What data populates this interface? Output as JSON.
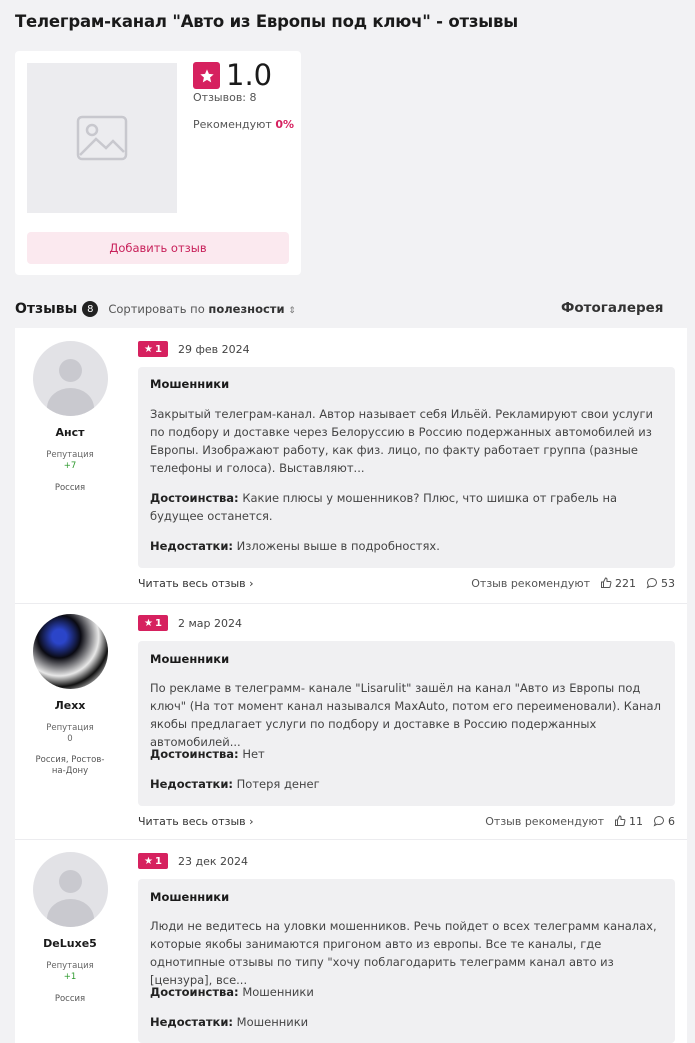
{
  "page_title": "Телеграм-канал \"Авто из Европы под ключ\" - отзывы",
  "summary": {
    "rating": "1.0",
    "reviews_label": "Отзывов: 8",
    "recommend_label": "Рекомендуют",
    "recommend_value": "0%",
    "add_review": "Добавить отзыв"
  },
  "reviews_bar": {
    "label": "Отзывы",
    "count": "8",
    "sort_prefix": "Сортировать по",
    "sort_value": "полезности",
    "gallery": "Фотогалерея"
  },
  "reviews": [
    {
      "author": "Анст",
      "rep_label": "Репутация",
      "rep_value": "+7",
      "city": "Россия",
      "rating": "1",
      "date": "29 фев 2024",
      "title": "Мошенники",
      "text": "Закрытый телеграм-канал. Автор называет себя Ильёй. Рекламируют свои услуги по подбору и доставке через Белоруссию в Россию подержанных автомобилей из Европы. Изображают работу, как физ. лицо, по факту работает группа (разные телефоны и голоса). Выставляют...",
      "pros_label": "Достоинства:",
      "pros": "Какие плюсы у мошенников? Плюс, что шишка от грабель на будущее останется.",
      "cons_label": "Недостатки:",
      "cons": "Изложены выше в подробностях.",
      "read_more": "Читать весь отзыв",
      "recommended": "Отзыв рекомендуют",
      "likes": "221",
      "comments": "53"
    },
    {
      "author": "Лехх",
      "rep_label": "Репутация",
      "rep_value": "0",
      "city": "Россия, Ростов-на-Дону",
      "rating": "1",
      "date": "2 мар 2024",
      "title": "Мошенники",
      "text": "По рекламе в телеграмм- канале \"Lisarulit\" зашёл на канал \"Авто из Европы под ключ\" (На тот момент канал назывался MaxAuto, потом его переименовали). Канал якобы предлагает услуги по подбору и доставке в Россию подержанных автомобилей...",
      "pros_label": "Достоинства:",
      "pros": "Нет",
      "cons_label": "Недостатки:",
      "cons": "Потеря денег",
      "read_more": "Читать весь отзыв",
      "recommended": "Отзыв рекомендуют",
      "likes": "11",
      "comments": "6"
    },
    {
      "author": "DeLuxe5",
      "rep_label": "Репутация",
      "rep_value": "+1",
      "city": "Россия",
      "rating": "1",
      "date": "23 дек 2024",
      "title": "Мошенники",
      "text": "Люди не ведитесь на уловки мошенников. Речь пойдет о всех телеграмм каналах, которые якобы занимаются пригоном авто из европы. Все те каналы, где однотипные отзывы по типу \"хочу поблагодарить телеграмм канал авто из [цензура], все...",
      "pros_label": "Достоинства:",
      "pros": "Мошенники",
      "cons_label": "Недостатки:",
      "cons": "Мошенники"
    }
  ],
  "colors": {
    "accent": "#d6215f",
    "accent_light": "#fbe9ef",
    "positive": "#2e9a2e"
  },
  "icons": [
    "image-placeholder-icon",
    "star-icon",
    "chevron-right-icon",
    "thumbs-up-icon",
    "comment-icon",
    "sort-arrows-icon"
  ]
}
